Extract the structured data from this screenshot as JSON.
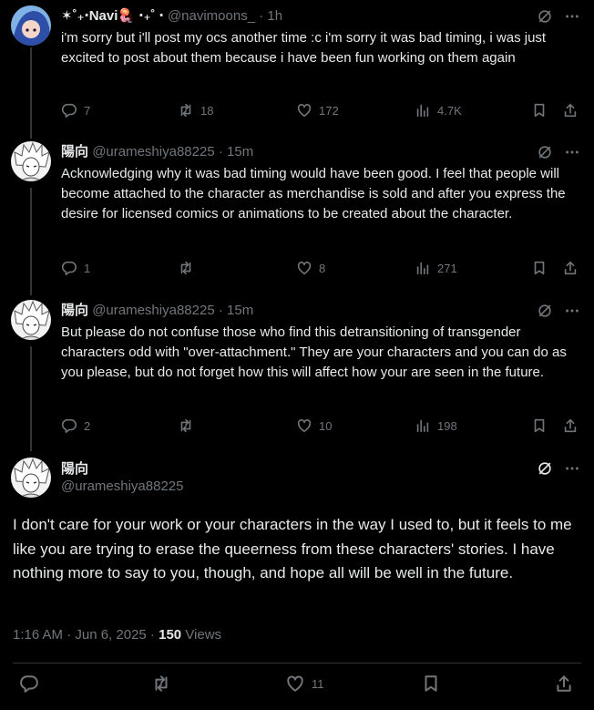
{
  "tweets": [
    {
      "name": "✶˚₊‧Navi🪼 ‧₊˚ ‧",
      "handle": "@navimoons_",
      "time": "1h",
      "text": "i'm sorry but i'll post my ocs another time :c i'm sorry it was bad timing, i was just excited to post about them because i have been fun working on them again",
      "replies": "7",
      "retweets": "18",
      "likes": "172",
      "views": "4.7K"
    },
    {
      "name": "陽向",
      "handle": "@urameshiya88225",
      "time": "15m",
      "text": "Acknowledging why it was bad timing would have been good. I feel that people will become attached to the character as merchandise is sold and after you express the desire for licensed comics or animations to be created about the character.",
      "replies": "1",
      "retweets": "",
      "likes": "8",
      "views": "271"
    },
    {
      "name": "陽向",
      "handle": "@urameshiya88225",
      "time": "15m",
      "text": "But please do not confuse those who find this detransitioning of transgender characters odd with \"over-attachment.\" They are your characters and you can do as you please, but do not forget how this will affect how your are seen in the future.",
      "replies": "2",
      "retweets": "",
      "likes": "10",
      "views": "198"
    }
  ],
  "separator": "·",
  "main": {
    "name": "陽向",
    "handle": "@urameshiya88225",
    "text": "I don't care for your work or your characters in the way I used to, but it feels to me like you are trying to erase the queerness from these characters' stories. I have nothing more to say to you, though, and hope all will be well in the future.",
    "date": "1:16 AM · Jun 6, 2025 ·",
    "views_count": "150",
    "views_label": "Views",
    "likes": "11"
  },
  "icons": [
    "grok-icon",
    "more-icon",
    "reply-icon",
    "retweet-icon",
    "like-icon",
    "views-icon",
    "bookmark-icon",
    "share-icon"
  ],
  "colors": {
    "background": "#000000",
    "text": "#e7e9ea",
    "muted": "#71767b",
    "divider": "#2f3336"
  }
}
